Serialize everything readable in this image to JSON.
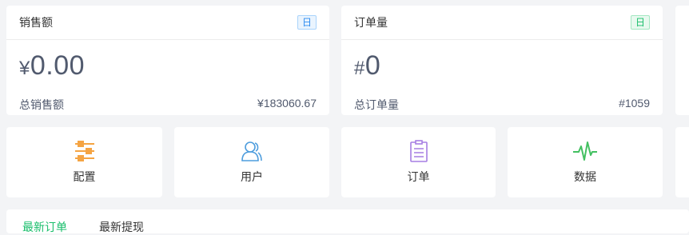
{
  "sales": {
    "title": "销售额",
    "badge": "日",
    "currency": "¥",
    "value": "0.00",
    "total_label": "总销售额",
    "total_value": "¥183060.67"
  },
  "orders": {
    "title": "订单量",
    "badge": "日",
    "currency": "#",
    "value": "0",
    "total_label": "总订单量",
    "total_value": "#1059"
  },
  "nav": {
    "items": [
      {
        "label": "配置",
        "icon": "settings-sliders-icon",
        "color": "#f5a443"
      },
      {
        "label": "用户",
        "icon": "user-icon",
        "color": "#4e9ddd"
      },
      {
        "label": "订单",
        "icon": "order-clipboard-icon",
        "color": "#a67ee3"
      },
      {
        "label": "数据",
        "icon": "pulse-chart-icon",
        "color": "#43c061"
      }
    ]
  },
  "tabs": [
    "最新订单",
    "最新提现"
  ],
  "colors": {
    "accent": "#19be6b",
    "background": "#f3f4f6"
  }
}
